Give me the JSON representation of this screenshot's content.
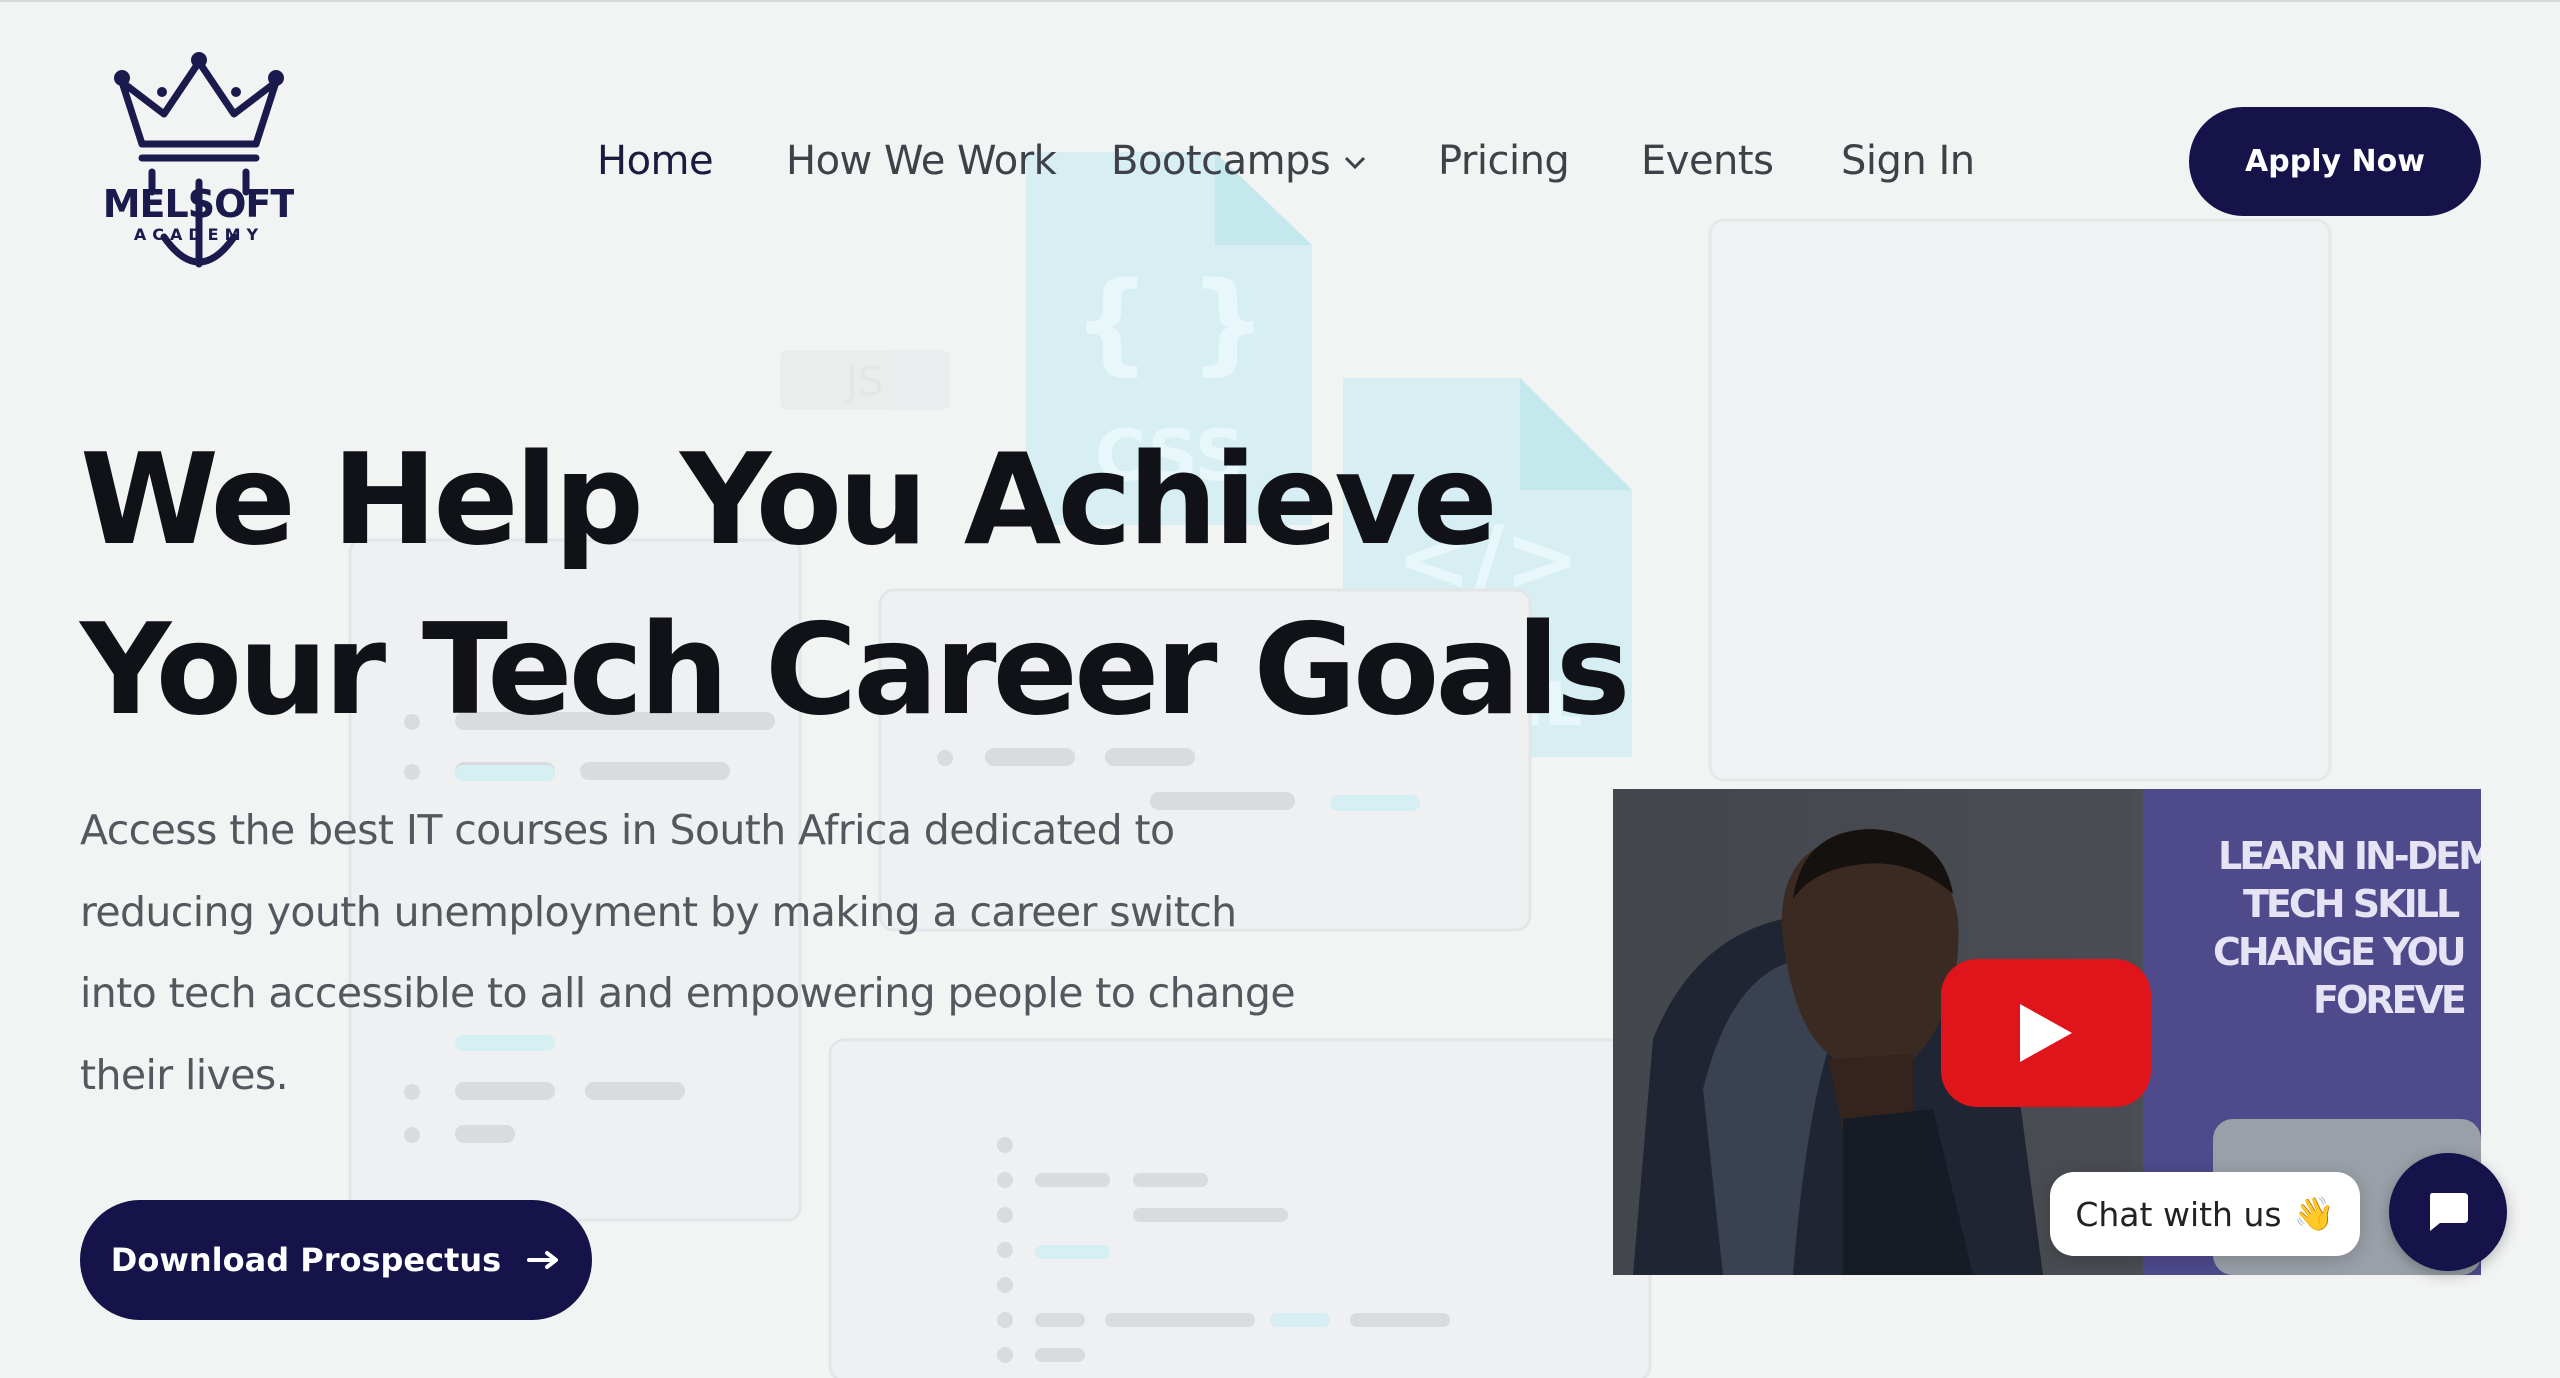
{
  "brand": {
    "name": "MELSOFT",
    "sub": "ACADEMY"
  },
  "nav": {
    "items": [
      "Home",
      "How We Work",
      "Bootcamps",
      "Pricing",
      "Events",
      "Sign In"
    ],
    "apply_label": "Apply Now"
  },
  "hero": {
    "title_line1": "We Help You Achieve",
    "title_line2": "Your Tech Career Goals",
    "desc_line1": "Access the best IT courses in South Africa dedicated to",
    "desc_line2": "reducing youth unemployment by making a career switch",
    "desc_line3": "into tech accessible to all and empowering people to change",
    "desc_line4": "their lives.",
    "download_label": "Download Prospectus"
  },
  "video": {
    "banner_line1": "LEARN IN-DEM",
    "banner_line2": "TECH SKILL",
    "banner_line3": "CHANGE YOU",
    "banner_line4": "FOREVE"
  },
  "chat": {
    "label": "Chat with us",
    "emoji": "👋"
  },
  "decor": {
    "file1": "CSS",
    "file2": "HTML",
    "file1_glyph": "{ }",
    "file2_glyph": "</>",
    "file3": "JS"
  },
  "colors": {
    "primary": "#16124a",
    "play_red": "#e0141b",
    "decor_cyan": "#cdeef2"
  }
}
